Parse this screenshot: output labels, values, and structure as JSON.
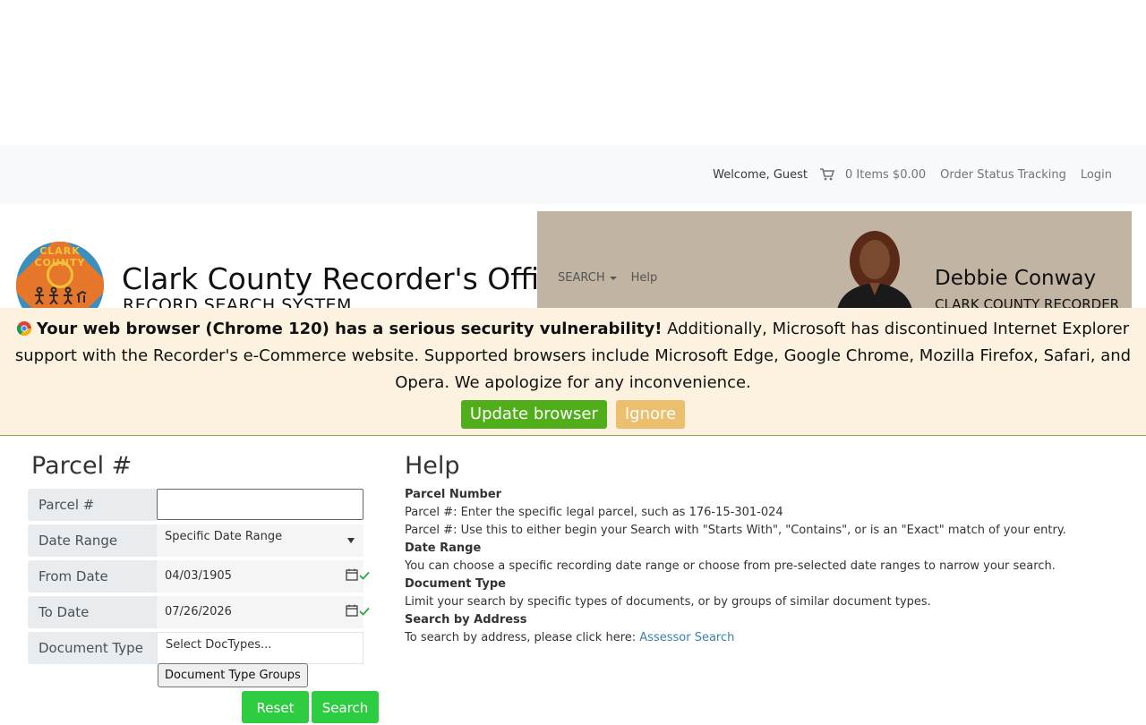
{
  "topbar": {
    "welcome": "Welcome, Guest",
    "cart": "0 Items $0.00",
    "order_status": "Order Status Tracking",
    "login": "Login"
  },
  "header": {
    "logo_text": "CLARK COUNTY",
    "title": "Clark County Recorder's Office",
    "subtitle": "RECORD SEARCH SYSTEM",
    "nav": {
      "search": "SEARCH",
      "help": "Help"
    },
    "official_name": "Debbie Conway",
    "official_title": "CLARK COUNTY RECORDER"
  },
  "alert": {
    "bold": "Your web browser (Chrome 120) has a serious security vulnerability!",
    "text": " Additionally, Microsoft has discontinued Internet Explorer support with the Recorder's e-Commerce website. Supported browsers include Microsoft Edge, Google Chrome, Mozilla Firefox, Safari, and Opera. We apologize for any inconvenience.",
    "update_label": "Update browser",
    "ignore_label": "Ignore"
  },
  "form": {
    "title": "Parcel #",
    "parcel_label": "Parcel #",
    "parcel_value": "",
    "date_range_label": "Date Range",
    "date_range_value": "Specific Date Range",
    "from_label": "From Date",
    "from_value": "04/03/1905",
    "to_label": "To Date",
    "to_value": "07/26/2026",
    "doctype_label": "Document Type",
    "doctype_placeholder": "Select DocTypes...",
    "doctype_groups": "Document Type Groups",
    "reset": "Reset",
    "search": "Search"
  },
  "help": {
    "title": "Help",
    "parcel_hd": "Parcel Number",
    "parcel_1": "Parcel #: Enter the specific legal parcel, such as 176-15-301-024",
    "parcel_2": "Parcel #: Use this to either begin your Search with \"Starts With\", \"Contains\", or is an \"Exact\" match of your entry.",
    "date_hd": "Date Range",
    "date_1": "You can choose a specific recording date range or choose from pre-selected date ranges to narrow your search.",
    "doc_hd": "Document Type",
    "doc_1": "Limit your search by specific types of documents, or by groups of similar document types.",
    "addr_hd": "Search by Address",
    "addr_1": "To search by address, please click here: ",
    "addr_link": "Assessor Search"
  },
  "colors": {
    "accent_green": "#2ecc40",
    "update_green": "#4fae1a",
    "ignore_yellow": "#ebbf6e",
    "banner": "#c2b4a3",
    "alert_bg": "#fdf2df"
  }
}
